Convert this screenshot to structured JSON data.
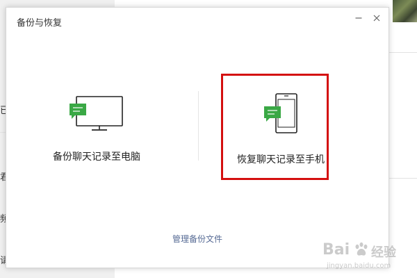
{
  "background": {
    "left_chars": [
      "已",
      "君",
      "频",
      "请"
    ]
  },
  "dialog": {
    "title": "备份与恢复",
    "minimize_symbol": "−",
    "close_symbol": "×",
    "options": [
      {
        "label": "备份聊天记录至电脑",
        "icon": "monitor-chat-icon"
      },
      {
        "label": "恢复聊天记录至手机",
        "icon": "phone-chat-icon"
      }
    ],
    "manage_link": "管理备份文件"
  },
  "watermark": {
    "brand": "Bai",
    "brand_suffix": "经验",
    "url": "jingyan.baidu.com"
  },
  "colors": {
    "accent_green": "#3aa845",
    "highlight_red": "#d40f0f",
    "link_blue": "#576b95"
  }
}
